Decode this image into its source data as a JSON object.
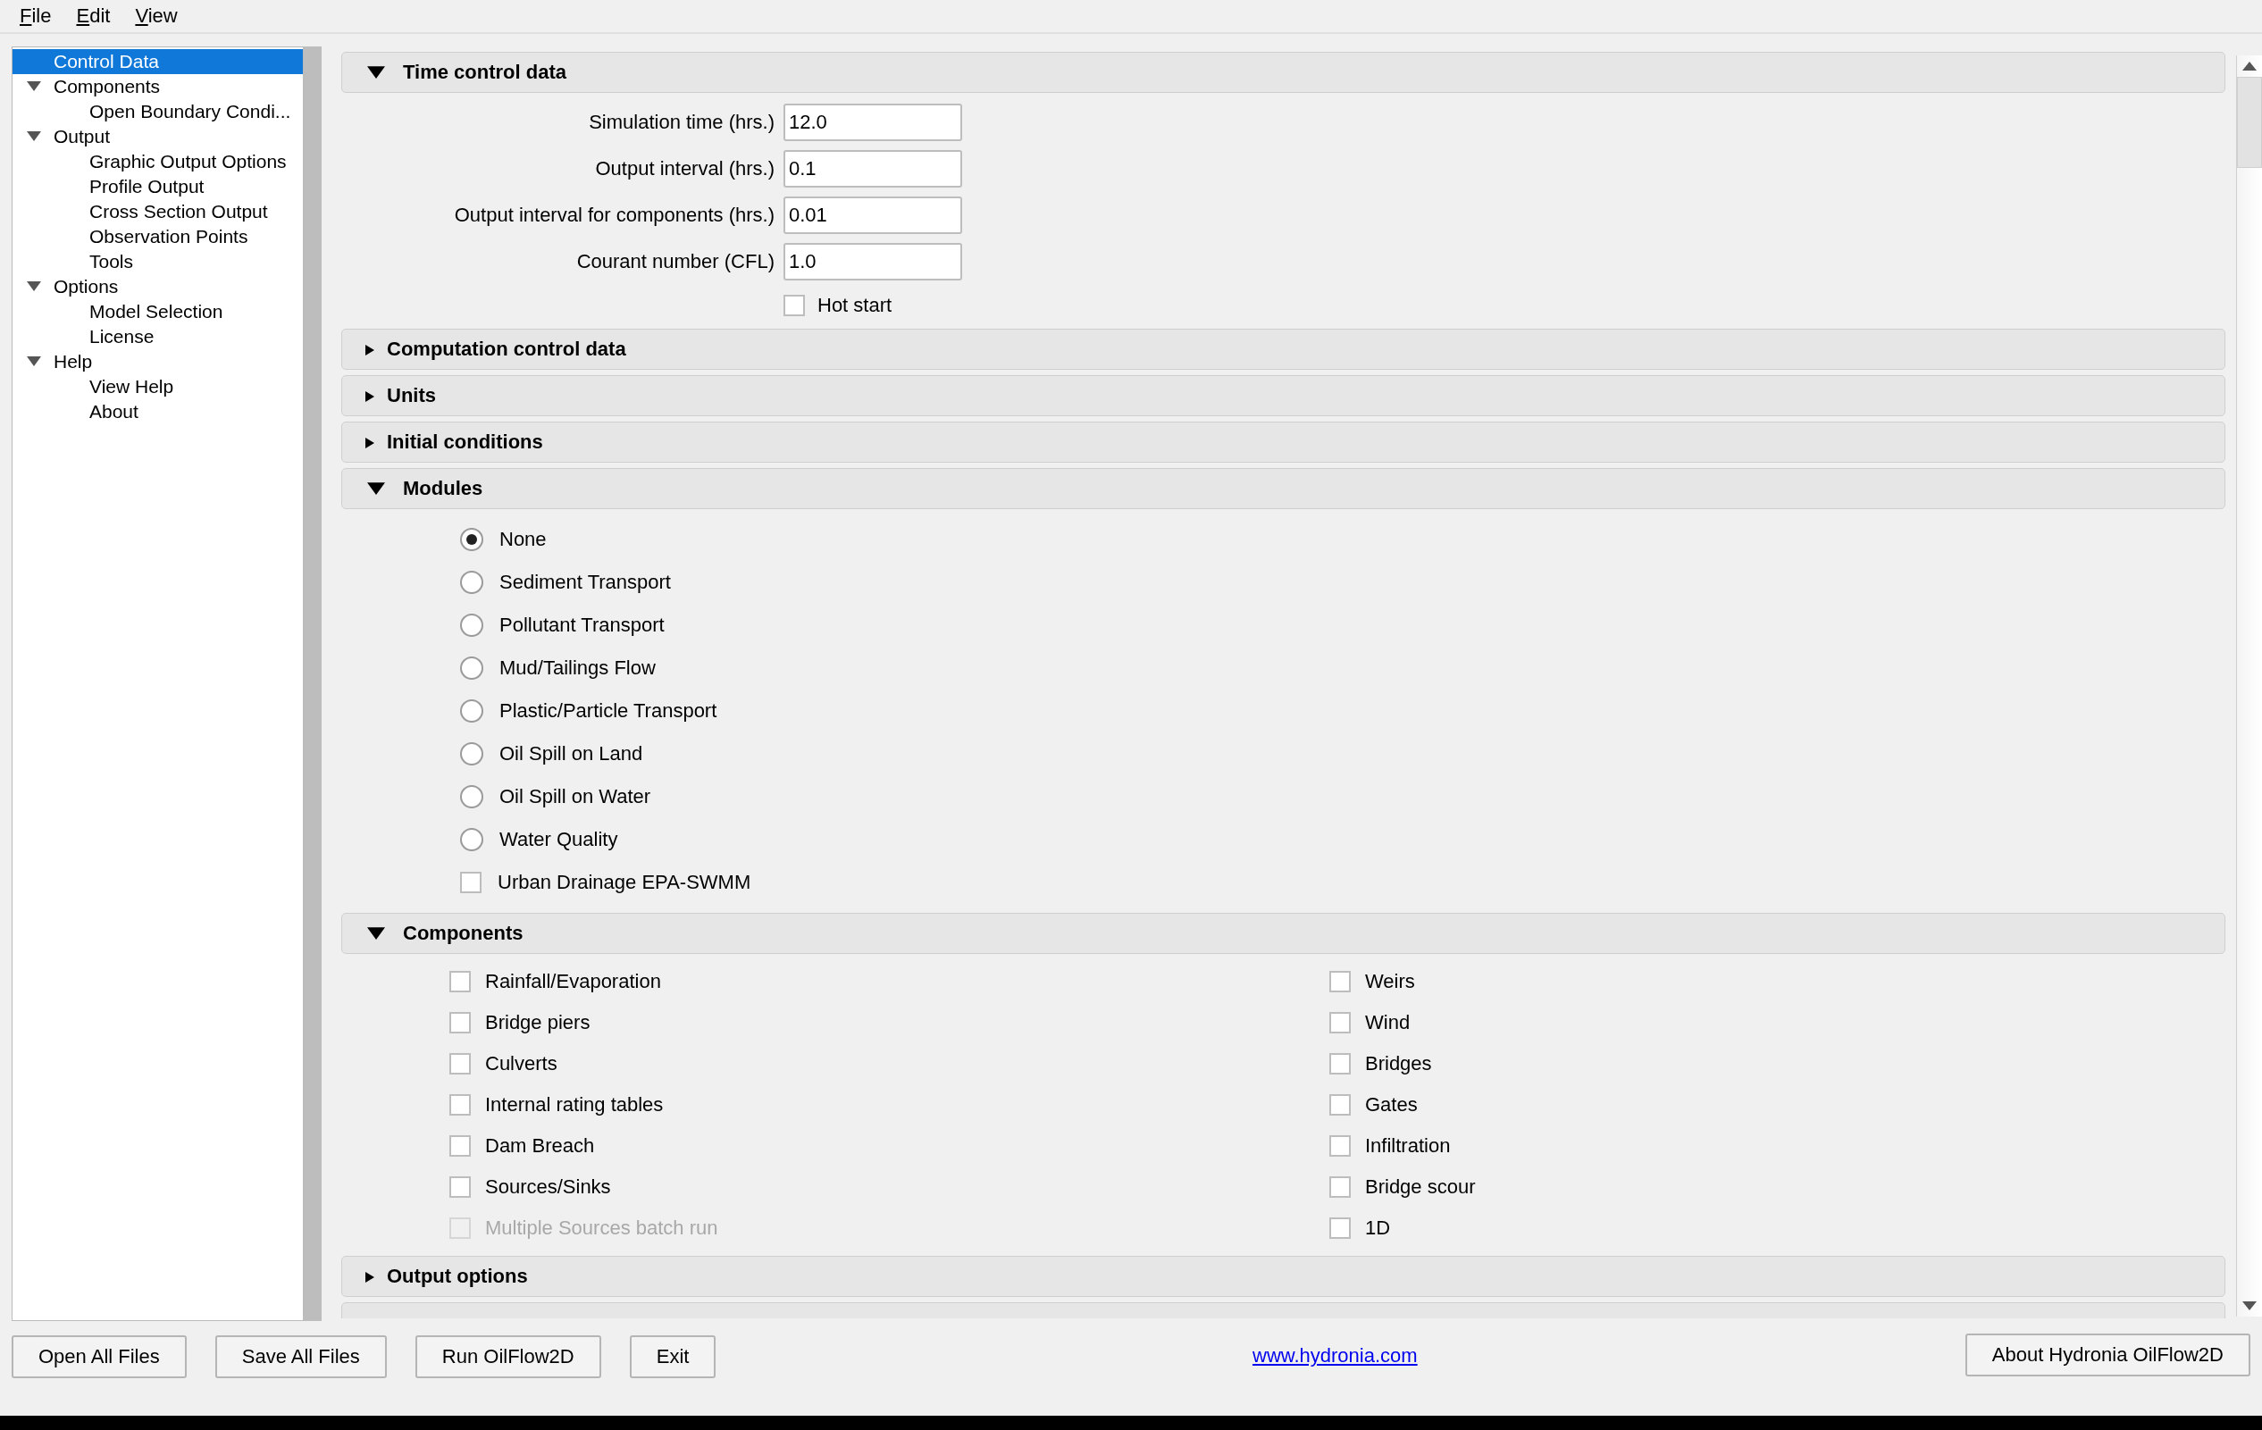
{
  "menu": [
    "File",
    "Edit",
    "View"
  ],
  "tree": [
    {
      "label": "Control Data",
      "selected": true
    },
    {
      "label": "Components",
      "selected": false,
      "expanded": true,
      "children": [
        {
          "label": "Open Boundary Condi...",
          "selected": false
        }
      ]
    },
    {
      "label": "Output",
      "selected": false,
      "expanded": true,
      "children": [
        {
          "label": "Graphic Output Options",
          "selected": false
        },
        {
          "label": "Profile Output",
          "selected": false
        },
        {
          "label": "Cross Section Output",
          "selected": false
        },
        {
          "label": "Observation Points",
          "selected": false
        },
        {
          "label": "Tools",
          "selected": false
        }
      ]
    },
    {
      "label": "Options",
      "selected": false,
      "expanded": true,
      "children": [
        {
          "label": "Model Selection",
          "selected": false
        },
        {
          "label": "License",
          "selected": false
        }
      ]
    },
    {
      "label": "Help",
      "selected": false,
      "expanded": true,
      "children": [
        {
          "label": "View Help",
          "selected": false
        },
        {
          "label": "About",
          "selected": false
        }
      ]
    }
  ],
  "sections": [
    {
      "kind": "fields",
      "title": "Time control data",
      "expanded": true,
      "fields": [
        {
          "label": "Simulation time (hrs.)",
          "value": "12.0"
        },
        {
          "label": "Output interval (hrs.)",
          "value": "0.1"
        },
        {
          "label": "Output interval for components (hrs.)",
          "value": "0.01"
        },
        {
          "label": "Courant number (CFL)",
          "value": "1.0"
        }
      ],
      "checkbox": {
        "label": "Hot start",
        "checked": false
      }
    },
    {
      "title": "Computation control data",
      "expanded": false
    },
    {
      "title": "Units",
      "expanded": false
    },
    {
      "title": "Initial conditions",
      "expanded": false
    },
    {
      "kind": "options",
      "title": "Modules",
      "expanded": true,
      "options": [
        {
          "kind": "radio",
          "label": "None",
          "selected": true
        },
        {
          "kind": "radio",
          "label": "Sediment Transport",
          "selected": false
        },
        {
          "kind": "radio",
          "label": "Pollutant Transport",
          "selected": false
        },
        {
          "kind": "radio",
          "label": "Mud/Tailings Flow",
          "selected": false
        },
        {
          "kind": "radio",
          "label": "Plastic/Particle Transport",
          "selected": false
        },
        {
          "kind": "radio",
          "label": "Oil Spill on Land",
          "selected": false
        },
        {
          "kind": "radio",
          "label": "Oil Spill on Water",
          "selected": false
        },
        {
          "kind": "radio",
          "label": "Water Quality",
          "selected": false
        },
        {
          "kind": "checkbox",
          "label": "Urban Drainage EPA-SWMM",
          "checked": false
        }
      ]
    },
    {
      "kind": "columns",
      "title": "Components",
      "expanded": true,
      "columns": [
        [
          {
            "label": "Rainfall/Evaporation",
            "checked": false,
            "disabled": false
          },
          {
            "label": "Bridge piers",
            "checked": false,
            "disabled": false
          },
          {
            "label": "Culverts",
            "checked": false,
            "disabled": false
          },
          {
            "label": "Internal rating tables",
            "checked": false,
            "disabled": false
          },
          {
            "label": "Dam Breach",
            "checked": false,
            "disabled": false
          },
          {
            "label": "Sources/Sinks",
            "checked": false,
            "disabled": false
          },
          {
            "label": "Multiple Sources batch run",
            "checked": false,
            "disabled": true
          }
        ],
        [
          {
            "label": "Weirs",
            "checked": false,
            "disabled": false
          },
          {
            "label": "Wind",
            "checked": false,
            "disabled": false
          },
          {
            "label": "Bridges",
            "checked": false,
            "disabled": false
          },
          {
            "label": "Gates",
            "checked": false,
            "disabled": false
          },
          {
            "label": "Infiltration",
            "checked": false,
            "disabled": false
          },
          {
            "label": "Bridge scour",
            "checked": false,
            "disabled": false
          },
          {
            "label": "1D",
            "checked": false,
            "disabled": false
          }
        ]
      ]
    },
    {
      "title": "Output options",
      "expanded": false
    }
  ],
  "buttons": [
    "Open All Files",
    "Save All Files",
    "Run OilFlow2D",
    "Exit"
  ],
  "link": "www.hydronia.com",
  "about_button": "About Hydronia OilFlow2D"
}
